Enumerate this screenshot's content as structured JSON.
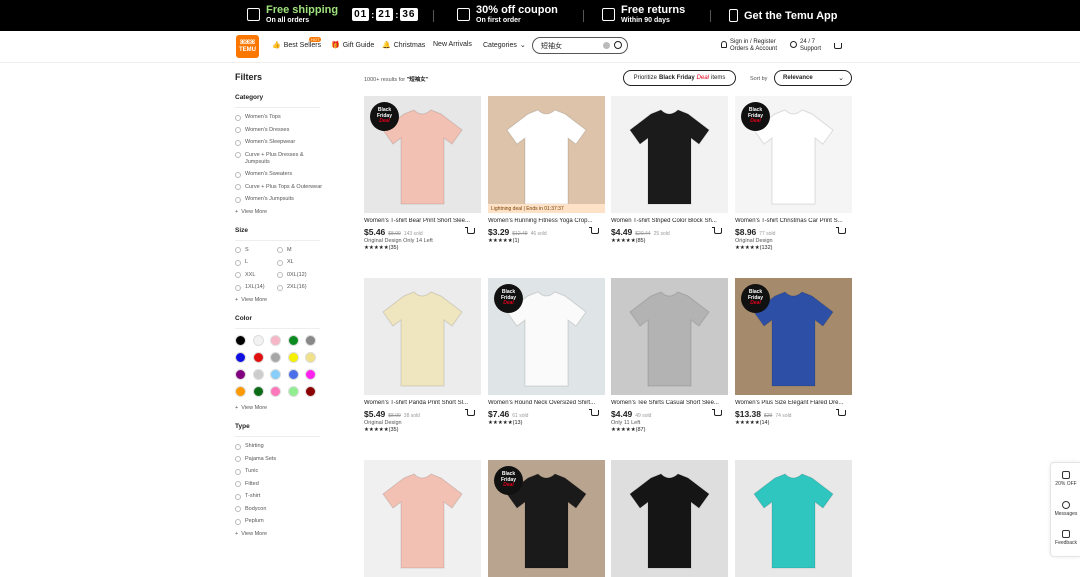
{
  "promo": {
    "shipping_title": "Free shipping",
    "shipping_sub": "On all orders",
    "timer": [
      "01",
      "21",
      "36"
    ],
    "coupon_title": "30% off coupon",
    "coupon_sub": "On first order",
    "returns_title": "Free returns",
    "returns_sub": "Within 90 days",
    "app_label": "Get the Temu App"
  },
  "nav": {
    "logo_top": "ꕤꕤꕤ",
    "logo_bottom": "TEMU",
    "best_sellers": "Best Sellers",
    "hot_badge": "HOT",
    "gift_guide": "Gift Guide",
    "christmas": "Christmas",
    "new_arrivals": "New Arrivals",
    "categories": "Categories",
    "search_value": "短袖女",
    "signin_line1": "Sign in / Register",
    "signin_line2": "Orders & Account",
    "support_line1": "24 / 7",
    "support_line2": "Support"
  },
  "filters": {
    "title": "Filters",
    "category_label": "Category",
    "categories": [
      "Women's Tops",
      "Women's Dresses",
      "Women's Sleepwear",
      "Curve + Plus Dresses & Jumpsuits",
      "Women's Sweaters",
      "Curve + Plus Tops & Outerwear",
      "Women's Jumpsuits"
    ],
    "view_more": "View More",
    "size_label": "Size",
    "sizes": [
      "S",
      "M",
      "L",
      "XL",
      "XXL",
      "0XL(12)",
      "1XL(14)",
      "2XL(16)"
    ],
    "color_label": "Color",
    "colors": [
      "#000000",
      "#f2f2f2",
      "#f7b6c6",
      "#0a8a1f",
      "#888888",
      "#1010e0",
      "#e01010",
      "#a6a6a6",
      "#f5f000",
      "#f0e08a",
      "#800080",
      "#cccccc",
      "#87cefa",
      "#4a6fe8",
      "#ff22ee",
      "#ff9900",
      "#0b6b16",
      "#ff77bb",
      "#90ee90",
      "#8b0000"
    ],
    "type_label": "Type",
    "types": [
      "Shirting",
      "Pajama Sets",
      "Tunic",
      "Fitted",
      "T-shirt",
      "Bodycon",
      "Peplum"
    ]
  },
  "results": {
    "count_prefix": "1000+ results for ",
    "query": "\"短袖女\"",
    "prioritize_prefix": "Prioritize",
    "prioritize_black": "Black Friday",
    "prioritize_deal": "Deal",
    "prioritize_suffix": "items",
    "sort_label": "Sort by",
    "sort_value": "Relevance"
  },
  "badge": {
    "line1": "Black",
    "line2": "Friday",
    "line3": "Deal"
  },
  "products": [
    {
      "name": "Women's T-shirt Bear Print Short Slee...",
      "price": "$5.46",
      "orig": "$8.99",
      "sold": "143 sold",
      "extra": "Original Design   Only 14 Left",
      "stars": "★★★★★(35)",
      "bg": "#e7e7e7",
      "tee": "#f3c1b3",
      "badge": true
    },
    {
      "name": "Women's Running Fitness Yoga Crop...",
      "price": "$3.29",
      "orig": "$12.49",
      "sold": "46 sold",
      "extra": "",
      "stars": "★★★★★(1)",
      "bg": "#dcc3a9",
      "tee": "#ffffff",
      "badge": false,
      "lightning": "Lightning deal | Ends in 01:37:37"
    },
    {
      "name": "Women T-shirt Striped Color Block Sh...",
      "price": "$4.49",
      "orig": "$20.44",
      "sold": "25 sold",
      "extra": "",
      "stars": "★★★★★(85)",
      "bg": "#f2f2f2",
      "tee": "#1b1b1b",
      "badge": false
    },
    {
      "name": "Women's T-shirt Christmas Car Print S...",
      "price": "$8.96",
      "orig": "",
      "sold": "77 sold",
      "extra": "Original Design",
      "stars": "★★★★★(132)",
      "bg": "#f5f5f5",
      "tee": "#ffffff",
      "badge": true
    },
    {
      "name": "Women's T-shirt Panda Print Short Sl...",
      "price": "$5.49",
      "orig": "$8.99",
      "sold": "38 sold",
      "extra": "Original Design",
      "stars": "★★★★★(35)",
      "bg": "#ececec",
      "tee": "#efe6bf",
      "badge": false
    },
    {
      "name": "Women's Round Neck Oversized Shirt...",
      "price": "$7.46",
      "orig": "",
      "sold": "61 sold",
      "extra": "",
      "stars": "★★★★★(13)",
      "bg": "#dfe4e6",
      "tee": "#fafafa",
      "badge": true
    },
    {
      "name": "Women's Tee Shirts Casual Short Slee...",
      "price": "$4.49",
      "orig": "",
      "sold": "49 sold",
      "extra": "Only 11 Left",
      "stars": "★★★★★(87)",
      "bg": "#c9c9c9",
      "tee": "#b3b3b3",
      "badge": false
    },
    {
      "name": "Women's Plus Size Elegant Flared Dre...",
      "price": "$13.38",
      "orig": "$29",
      "sold": "74 sold",
      "extra": "",
      "stars": "★★★★★(14)",
      "bg": "#a58b6c",
      "tee": "#2d4fa6",
      "badge": true
    },
    {
      "name": "",
      "price": "",
      "orig": "",
      "sold": "",
      "extra": "",
      "stars": "",
      "bg": "#f0f0f0",
      "tee": "#f3c1b3",
      "badge": false
    },
    {
      "name": "",
      "price": "",
      "orig": "",
      "sold": "",
      "extra": "",
      "stars": "",
      "bg": "#b9a48f",
      "tee": "#1a1a1a",
      "badge": true
    },
    {
      "name": "",
      "price": "",
      "orig": "",
      "sold": "",
      "extra": "",
      "stars": "",
      "bg": "#dedede",
      "tee": "#151515",
      "badge": false
    },
    {
      "name": "",
      "price": "",
      "orig": "",
      "sold": "",
      "extra": "",
      "stars": "",
      "bg": "#e8e8e8",
      "tee": "#2fc6c0",
      "badge": false
    }
  ],
  "side": {
    "off": "20% OFF",
    "messages": "Messages",
    "feedback": "Feedback"
  }
}
